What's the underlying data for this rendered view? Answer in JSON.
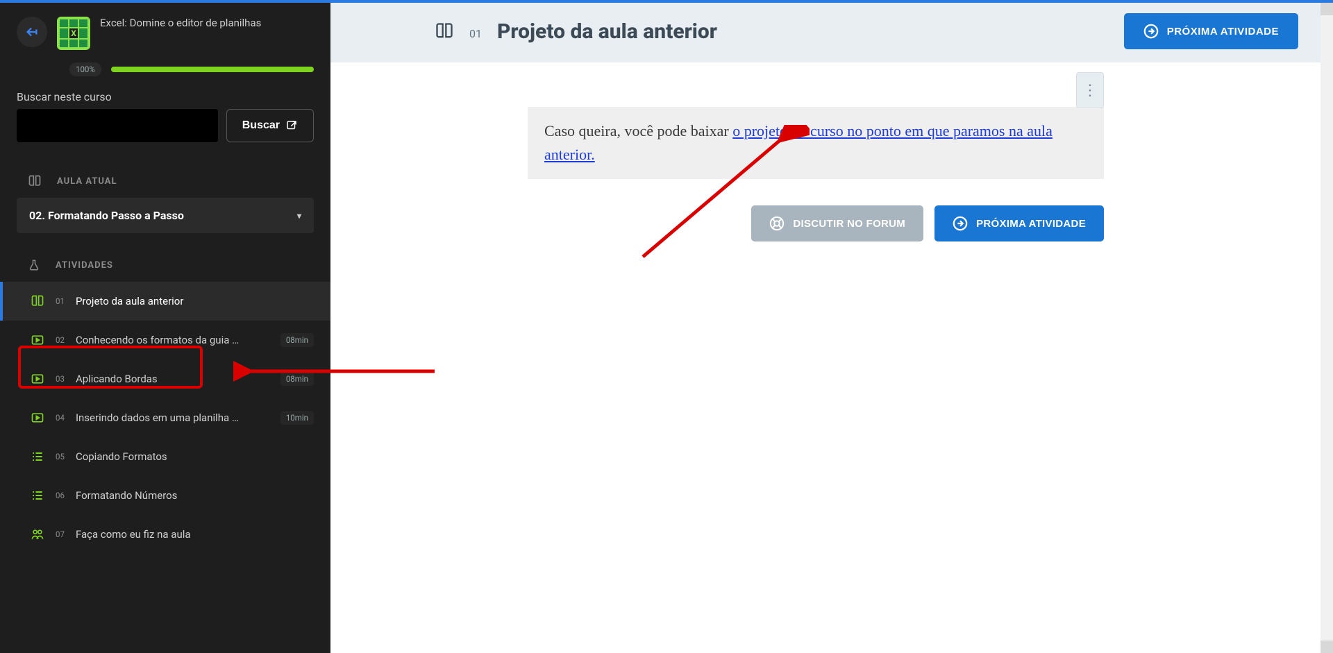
{
  "sidebar": {
    "course_title": "Excel: Domine o editor de planilhas",
    "progress_label": "100%",
    "progress_pct": 100,
    "search_label": "Buscar neste curso",
    "search_button": "Buscar",
    "section_current_lesson": "AULA ATUAL",
    "current_lesson": "02. Formatando Passo a Passo",
    "section_activities": "ATIVIDADES",
    "activities": [
      {
        "index": "01",
        "title": "Projeto da aula anterior",
        "icon": "open-book",
        "duration": "",
        "selected": true
      },
      {
        "index": "02",
        "title": "Conhecendo os formatos da guia …",
        "icon": "video",
        "duration": "08min",
        "selected": false
      },
      {
        "index": "03",
        "title": "Aplicando Bordas",
        "icon": "video",
        "duration": "08min",
        "selected": false
      },
      {
        "index": "04",
        "title": "Inserindo dados em uma planilha …",
        "icon": "video",
        "duration": "10min",
        "selected": false
      },
      {
        "index": "05",
        "title": "Copiando Formatos",
        "icon": "list",
        "duration": "",
        "selected": false
      },
      {
        "index": "06",
        "title": "Formatando Números",
        "icon": "list",
        "duration": "",
        "selected": false
      },
      {
        "index": "07",
        "title": "Faça como eu fiz na aula",
        "icon": "people",
        "duration": "",
        "selected": false
      }
    ]
  },
  "header": {
    "number": "01",
    "title": "Projeto da aula anterior",
    "next_button": "PRÓXIMA ATIVIDADE"
  },
  "content": {
    "text_before_link": "Caso queira, você pode baixar ",
    "link_text": "o projeto do curso no ponto em que paramos na aula anterior.",
    "forum_button": "DISCUTIR NO FORUM",
    "next_button": "PRÓXIMA ATIVIDADE"
  }
}
